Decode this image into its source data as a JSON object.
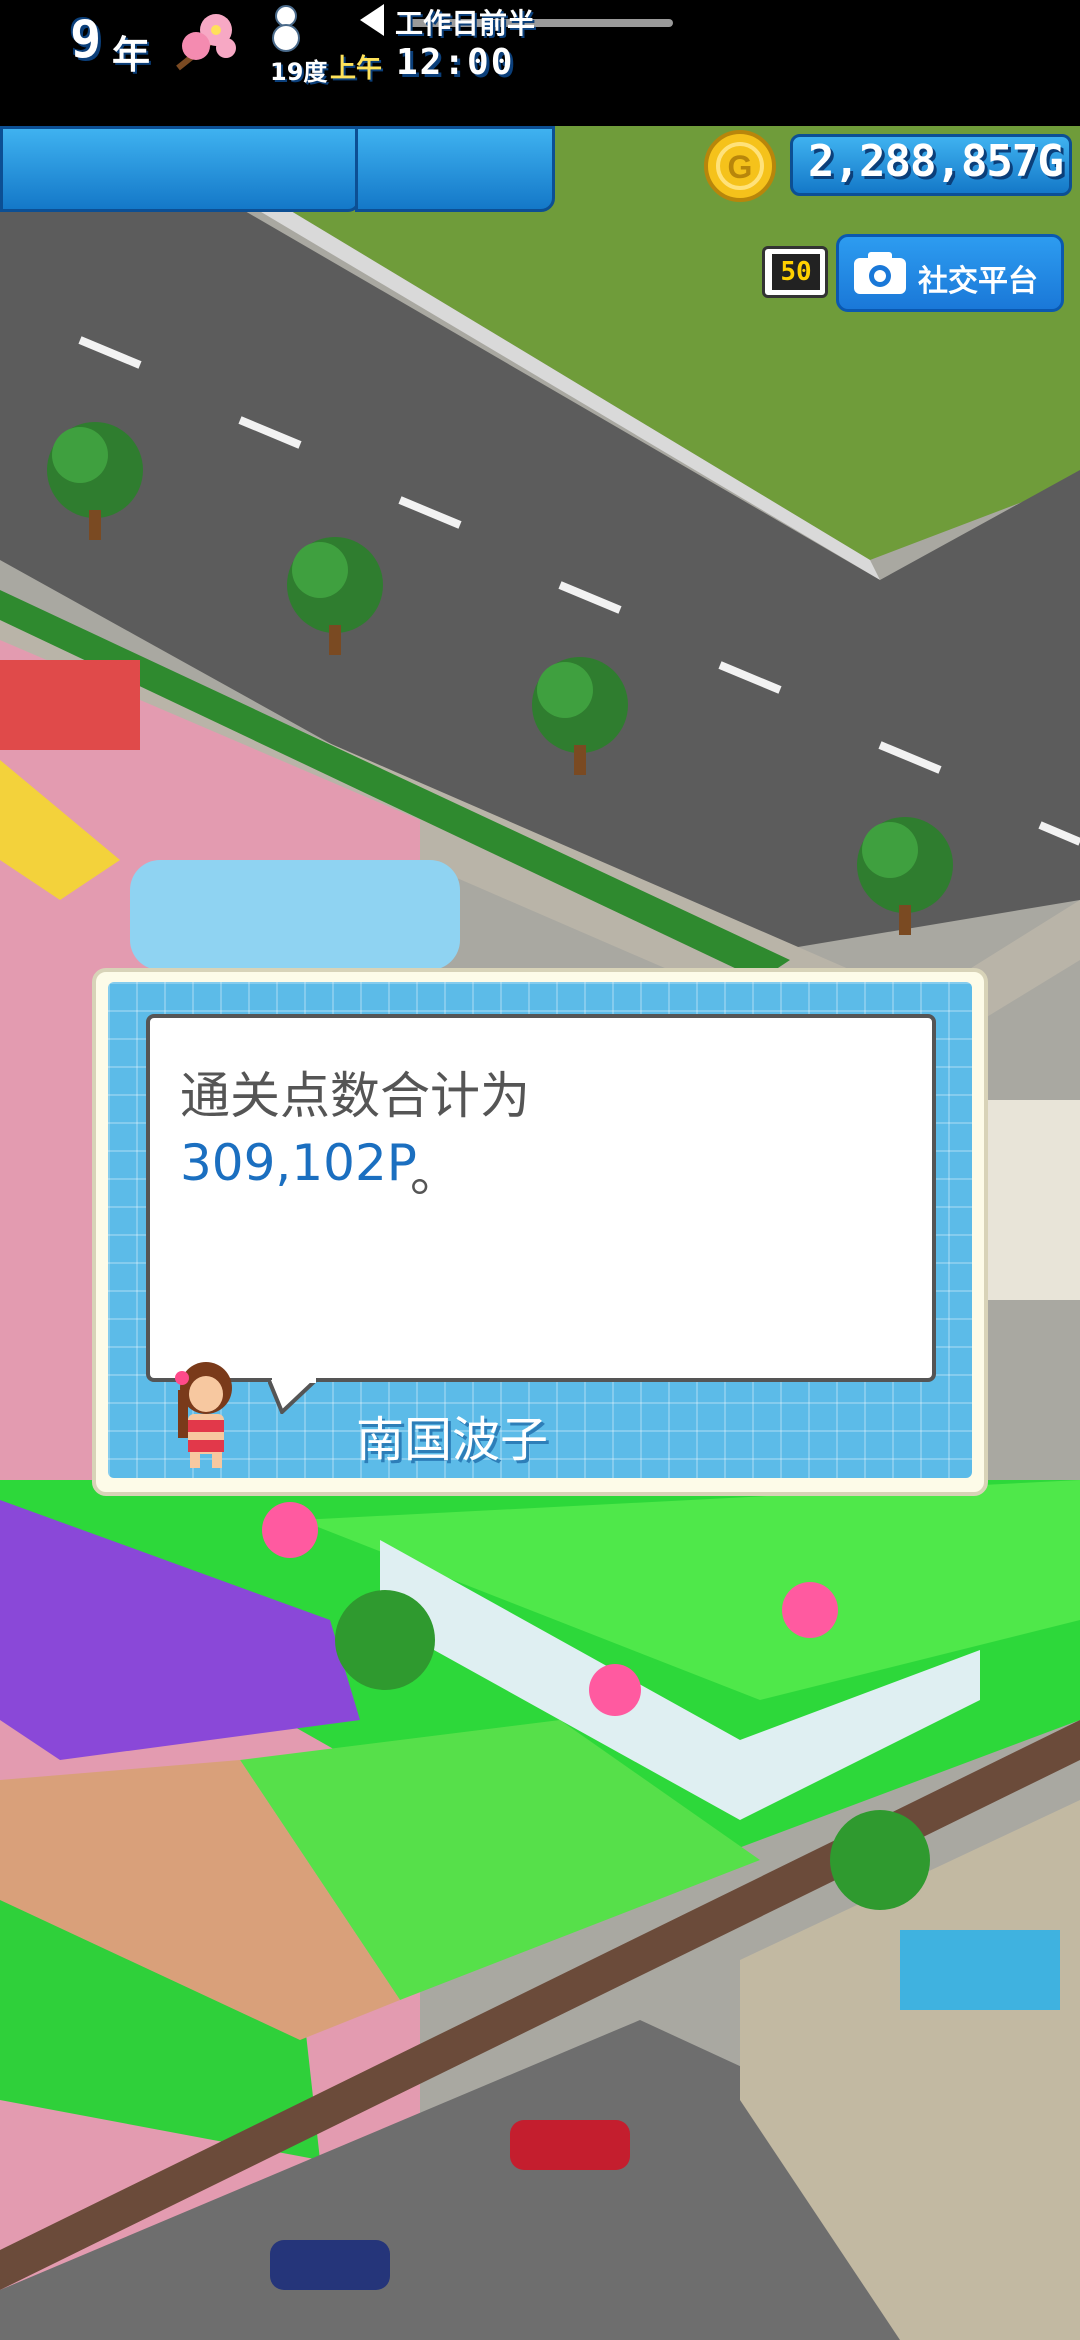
{
  "hud": {
    "year_number": "9",
    "year_unit": "年",
    "temperature": "19度",
    "day_period": "工作日前半",
    "am_pm": "上午",
    "clock": "12:00"
  },
  "money": {
    "amount": "2,288,857G"
  },
  "social": {
    "badge": "50",
    "label": "社交平台"
  },
  "dialog": {
    "line1": "通关点数合计为",
    "points": "309,102P",
    "punctuation": "。",
    "speaker": "南国波子"
  },
  "colors": {
    "hud_blue": "#1478c8",
    "dialog_blue": "#5cbbe8",
    "points_blue": "#1b6fc0",
    "road_gray": "#5c5c5c",
    "grass_green": "#6cc94a"
  }
}
